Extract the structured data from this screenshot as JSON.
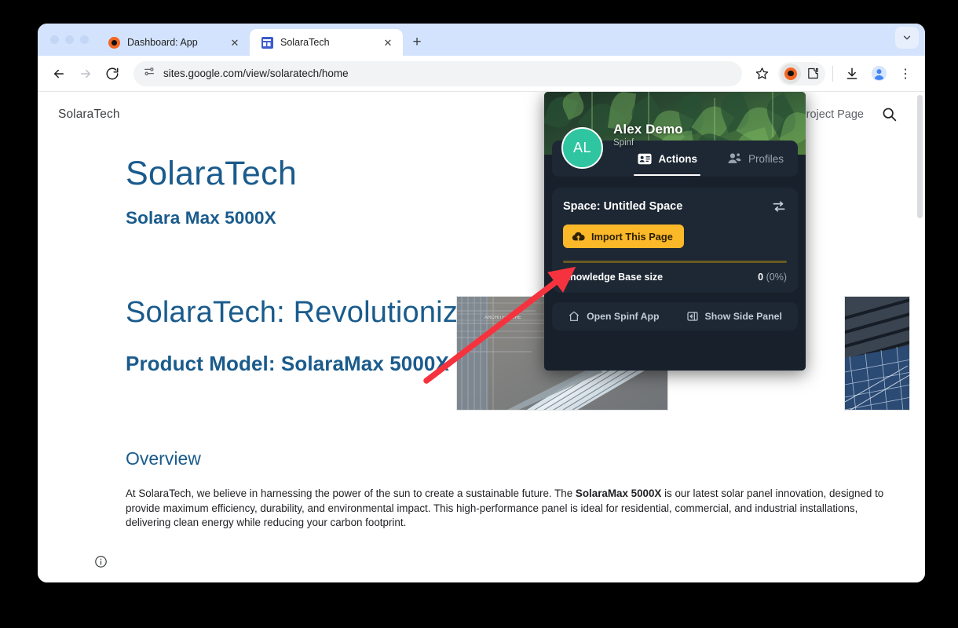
{
  "browser": {
    "tabs": [
      {
        "title": "Dashboard: App",
        "favicon": "spinf-dot-icon",
        "active": false,
        "close_label": "✕"
      },
      {
        "title": "SolaraTech",
        "favicon": "google-sites-icon",
        "active": true,
        "close_label": "✕"
      }
    ],
    "new_tab_label": "+",
    "toolbar": {
      "back_label": "←",
      "forward_label": "→",
      "reload_label": "↻",
      "url": "sites.google.com/view/solaratech/home",
      "bookmark_label": "☆",
      "download_label": "download-icon",
      "profile_label": "profile-icon",
      "menu_label": "⋮"
    }
  },
  "site": {
    "logo": "SolaraTech",
    "nav": {
      "project_page": "Project Page",
      "search": "search-icon"
    },
    "hero": {
      "title": "SolaraTech",
      "subtitle": "Solara Max 5000X"
    },
    "section": {
      "title": "SolaraTech: Revolutionizing Solar",
      "subtitle": "Product Model: SolaraMax 5000X"
    },
    "overview": {
      "heading": "Overview",
      "paragraph_part1": "At SolaraTech, we believe in harnessing the power of the sun to create a sustainable future. The ",
      "paragraph_bold": "SolaraMax 5000X",
      "paragraph_part2": " is our latest solar panel innovation, designed to provide maximum efficiency, durability, and environmental impact. This high-performance panel is ideal for residential, commercial, and industrial installations, delivering clean energy while reducing your carbon footprint."
    },
    "images": [
      {
        "alt": "Solar panels on glass building rooftop"
      },
      {
        "alt": "Blue solar panel array detail"
      }
    ],
    "page_info_icon": "info-icon"
  },
  "extension_panel": {
    "user": {
      "name": "Alex Demo",
      "subtitle": "Spinf",
      "initials": "AL"
    },
    "tabs": [
      {
        "label": "Actions",
        "icon": "actions-card-icon",
        "active": true
      },
      {
        "label": "Profiles",
        "icon": "profiles-people-icon",
        "active": false
      }
    ],
    "space": {
      "title": "Space: Untitled Space",
      "swap_icon": "swap-space-icon",
      "import_button": "Import This Page",
      "import_icon": "cloud-upload-icon"
    },
    "knowledge_base": {
      "label": "Knowledge Base size",
      "count": "0",
      "percent": "(0%)"
    },
    "footer": [
      {
        "label": "Open Spinf App",
        "icon": "home-icon"
      },
      {
        "label": "Show Side Panel",
        "icon": "side-panel-icon"
      }
    ]
  },
  "annotation": {
    "type": "arrow",
    "color": "#f5333f",
    "points_to": "Import This Page"
  },
  "colors": {
    "tab_strip": "#d3e3fd",
    "site_accent": "#1a5b8c",
    "panel_background": "#17202b",
    "panel_card": "#1d2834",
    "import_button": "#fbb829",
    "avatar": "#2ec5a0",
    "annotation_red": "#f5333f"
  }
}
